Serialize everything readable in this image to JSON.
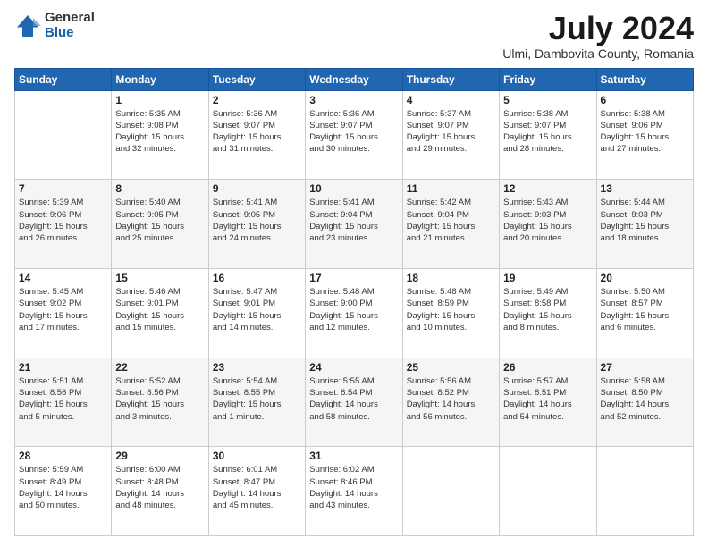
{
  "logo": {
    "general": "General",
    "blue": "Blue"
  },
  "header": {
    "month": "July 2024",
    "location": "Ulmi, Dambovita County, Romania"
  },
  "weekdays": [
    "Sunday",
    "Monday",
    "Tuesday",
    "Wednesday",
    "Thursday",
    "Friday",
    "Saturday"
  ],
  "weeks": [
    [
      {
        "day": "",
        "sunrise": "",
        "sunset": "",
        "daylight": ""
      },
      {
        "day": "1",
        "sunrise": "Sunrise: 5:35 AM",
        "sunset": "Sunset: 9:08 PM",
        "daylight": "Daylight: 15 hours and 32 minutes."
      },
      {
        "day": "2",
        "sunrise": "Sunrise: 5:36 AM",
        "sunset": "Sunset: 9:07 PM",
        "daylight": "Daylight: 15 hours and 31 minutes."
      },
      {
        "day": "3",
        "sunrise": "Sunrise: 5:36 AM",
        "sunset": "Sunset: 9:07 PM",
        "daylight": "Daylight: 15 hours and 30 minutes."
      },
      {
        "day": "4",
        "sunrise": "Sunrise: 5:37 AM",
        "sunset": "Sunset: 9:07 PM",
        "daylight": "Daylight: 15 hours and 29 minutes."
      },
      {
        "day": "5",
        "sunrise": "Sunrise: 5:38 AM",
        "sunset": "Sunset: 9:07 PM",
        "daylight": "Daylight: 15 hours and 28 minutes."
      },
      {
        "day": "6",
        "sunrise": "Sunrise: 5:38 AM",
        "sunset": "Sunset: 9:06 PM",
        "daylight": "Daylight: 15 hours and 27 minutes."
      }
    ],
    [
      {
        "day": "7",
        "sunrise": "Sunrise: 5:39 AM",
        "sunset": "Sunset: 9:06 PM",
        "daylight": "Daylight: 15 hours and 26 minutes."
      },
      {
        "day": "8",
        "sunrise": "Sunrise: 5:40 AM",
        "sunset": "Sunset: 9:05 PM",
        "daylight": "Daylight: 15 hours and 25 minutes."
      },
      {
        "day": "9",
        "sunrise": "Sunrise: 5:41 AM",
        "sunset": "Sunset: 9:05 PM",
        "daylight": "Daylight: 15 hours and 24 minutes."
      },
      {
        "day": "10",
        "sunrise": "Sunrise: 5:41 AM",
        "sunset": "Sunset: 9:04 PM",
        "daylight": "Daylight: 15 hours and 23 minutes."
      },
      {
        "day": "11",
        "sunrise": "Sunrise: 5:42 AM",
        "sunset": "Sunset: 9:04 PM",
        "daylight": "Daylight: 15 hours and 21 minutes."
      },
      {
        "day": "12",
        "sunrise": "Sunrise: 5:43 AM",
        "sunset": "Sunset: 9:03 PM",
        "daylight": "Daylight: 15 hours and 20 minutes."
      },
      {
        "day": "13",
        "sunrise": "Sunrise: 5:44 AM",
        "sunset": "Sunset: 9:03 PM",
        "daylight": "Daylight: 15 hours and 18 minutes."
      }
    ],
    [
      {
        "day": "14",
        "sunrise": "Sunrise: 5:45 AM",
        "sunset": "Sunset: 9:02 PM",
        "daylight": "Daylight: 15 hours and 17 minutes."
      },
      {
        "day": "15",
        "sunrise": "Sunrise: 5:46 AM",
        "sunset": "Sunset: 9:01 PM",
        "daylight": "Daylight: 15 hours and 15 minutes."
      },
      {
        "day": "16",
        "sunrise": "Sunrise: 5:47 AM",
        "sunset": "Sunset: 9:01 PM",
        "daylight": "Daylight: 15 hours and 14 minutes."
      },
      {
        "day": "17",
        "sunrise": "Sunrise: 5:48 AM",
        "sunset": "Sunset: 9:00 PM",
        "daylight": "Daylight: 15 hours and 12 minutes."
      },
      {
        "day": "18",
        "sunrise": "Sunrise: 5:48 AM",
        "sunset": "Sunset: 8:59 PM",
        "daylight": "Daylight: 15 hours and 10 minutes."
      },
      {
        "day": "19",
        "sunrise": "Sunrise: 5:49 AM",
        "sunset": "Sunset: 8:58 PM",
        "daylight": "Daylight: 15 hours and 8 minutes."
      },
      {
        "day": "20",
        "sunrise": "Sunrise: 5:50 AM",
        "sunset": "Sunset: 8:57 PM",
        "daylight": "Daylight: 15 hours and 6 minutes."
      }
    ],
    [
      {
        "day": "21",
        "sunrise": "Sunrise: 5:51 AM",
        "sunset": "Sunset: 8:56 PM",
        "daylight": "Daylight: 15 hours and 5 minutes."
      },
      {
        "day": "22",
        "sunrise": "Sunrise: 5:52 AM",
        "sunset": "Sunset: 8:56 PM",
        "daylight": "Daylight: 15 hours and 3 minutes."
      },
      {
        "day": "23",
        "sunrise": "Sunrise: 5:54 AM",
        "sunset": "Sunset: 8:55 PM",
        "daylight": "Daylight: 15 hours and 1 minute."
      },
      {
        "day": "24",
        "sunrise": "Sunrise: 5:55 AM",
        "sunset": "Sunset: 8:54 PM",
        "daylight": "Daylight: 14 hours and 58 minutes."
      },
      {
        "day": "25",
        "sunrise": "Sunrise: 5:56 AM",
        "sunset": "Sunset: 8:52 PM",
        "daylight": "Daylight: 14 hours and 56 minutes."
      },
      {
        "day": "26",
        "sunrise": "Sunrise: 5:57 AM",
        "sunset": "Sunset: 8:51 PM",
        "daylight": "Daylight: 14 hours and 54 minutes."
      },
      {
        "day": "27",
        "sunrise": "Sunrise: 5:58 AM",
        "sunset": "Sunset: 8:50 PM",
        "daylight": "Daylight: 14 hours and 52 minutes."
      }
    ],
    [
      {
        "day": "28",
        "sunrise": "Sunrise: 5:59 AM",
        "sunset": "Sunset: 8:49 PM",
        "daylight": "Daylight: 14 hours and 50 minutes."
      },
      {
        "day": "29",
        "sunrise": "Sunrise: 6:00 AM",
        "sunset": "Sunset: 8:48 PM",
        "daylight": "Daylight: 14 hours and 48 minutes."
      },
      {
        "day": "30",
        "sunrise": "Sunrise: 6:01 AM",
        "sunset": "Sunset: 8:47 PM",
        "daylight": "Daylight: 14 hours and 45 minutes."
      },
      {
        "day": "31",
        "sunrise": "Sunrise: 6:02 AM",
        "sunset": "Sunset: 8:46 PM",
        "daylight": "Daylight: 14 hours and 43 minutes."
      },
      {
        "day": "",
        "sunrise": "",
        "sunset": "",
        "daylight": ""
      },
      {
        "day": "",
        "sunrise": "",
        "sunset": "",
        "daylight": ""
      },
      {
        "day": "",
        "sunrise": "",
        "sunset": "",
        "daylight": ""
      }
    ]
  ]
}
